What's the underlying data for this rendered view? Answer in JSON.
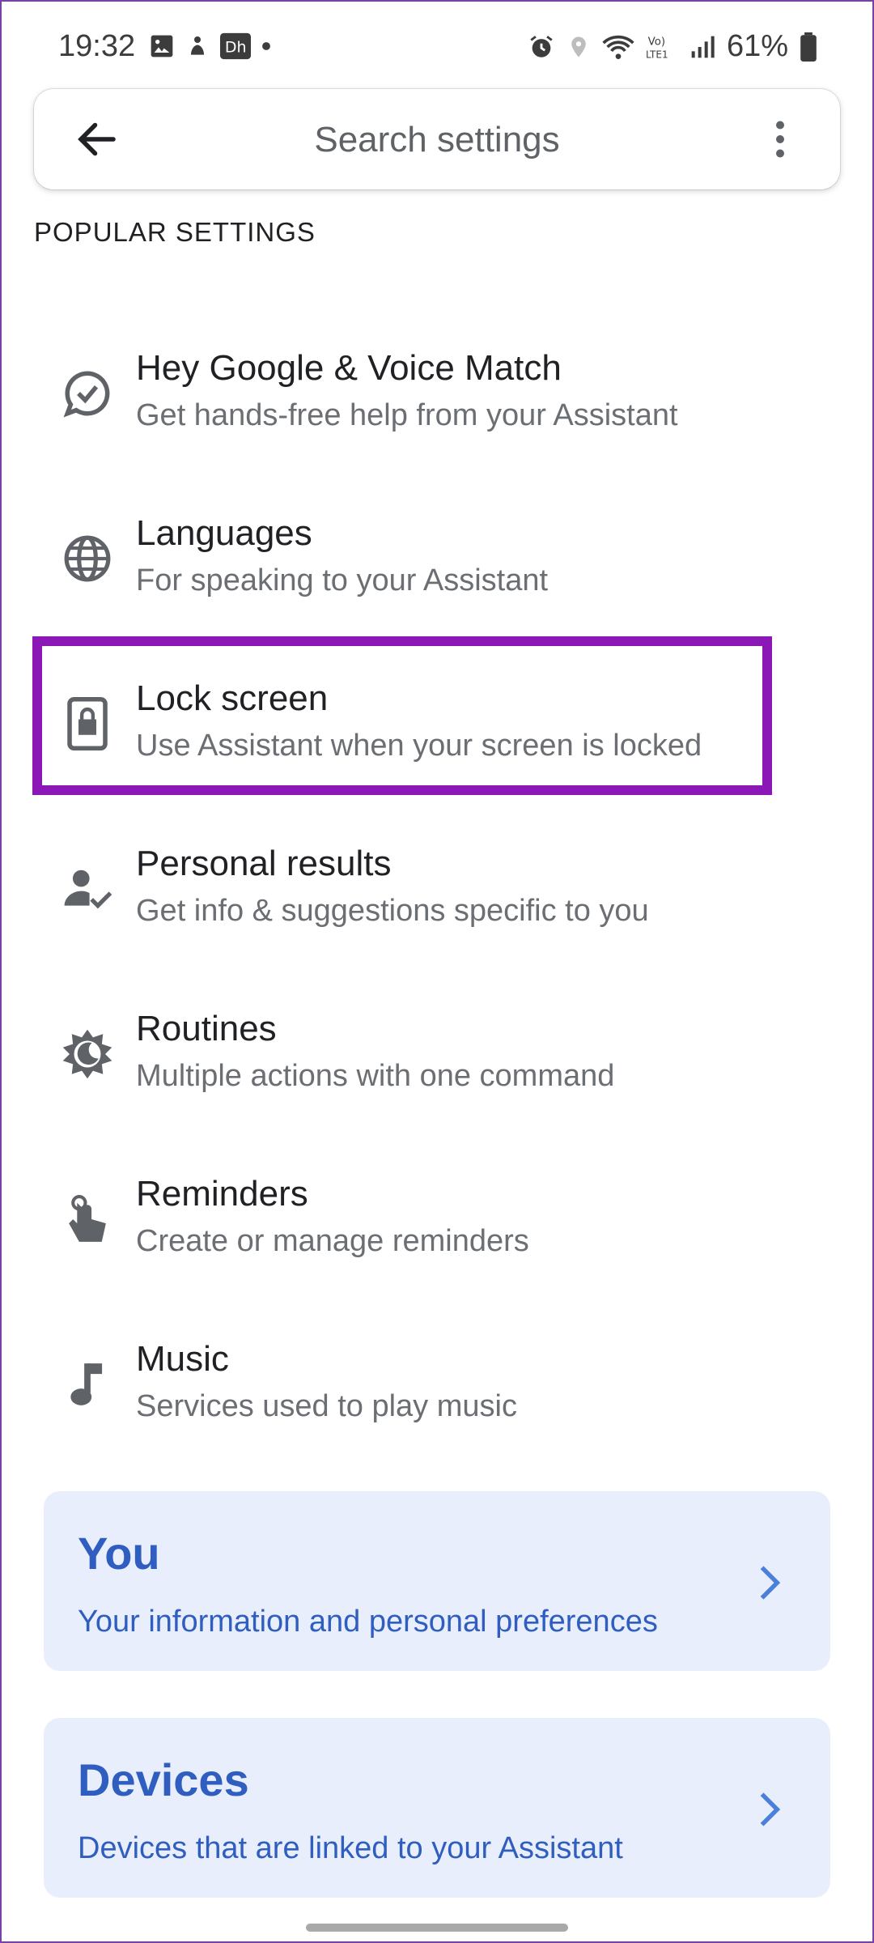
{
  "status_bar": {
    "time": "19:32",
    "battery_percent": "61%",
    "icons_left": [
      "gallery-icon",
      "game-icon",
      "disney-icon",
      "dot-icon"
    ],
    "icons_right": [
      "alarm-icon",
      "location-icon",
      "wifi-icon",
      "volte-icon",
      "signal-icon",
      "battery-icon"
    ]
  },
  "search": {
    "placeholder": "Search settings",
    "back_icon": "back-arrow-icon",
    "more_icon": "more-vert-icon"
  },
  "section_title": "POPULAR SETTINGS",
  "items": [
    {
      "icon": "voice-match-icon",
      "title": "Hey Google & Voice Match",
      "subtitle": "Get hands-free help from your Assistant"
    },
    {
      "icon": "globe-icon",
      "title": "Languages",
      "subtitle": "For speaking to your Assistant"
    },
    {
      "icon": "lock-screen-icon",
      "title": "Lock screen",
      "subtitle": "Use Assistant when your screen is locked"
    },
    {
      "icon": "personal-results-icon",
      "title": "Personal results",
      "subtitle": "Get info & suggestions specific to you"
    },
    {
      "icon": "routines-icon",
      "title": "Routines",
      "subtitle": "Multiple actions with one command"
    },
    {
      "icon": "reminders-icon",
      "title": "Reminders",
      "subtitle": "Create or manage reminders"
    },
    {
      "icon": "music-icon",
      "title": "Music",
      "subtitle": "Services used to play music"
    }
  ],
  "cards": [
    {
      "title": "You",
      "subtitle": "Your information and personal preferences"
    },
    {
      "title": "Devices",
      "subtitle": "Devices that are linked to your Assistant"
    }
  ],
  "colors": {
    "accent_blue": "#2f5ec0",
    "card_bg": "#e8eefb",
    "highlight_border": "#8a17b6"
  }
}
